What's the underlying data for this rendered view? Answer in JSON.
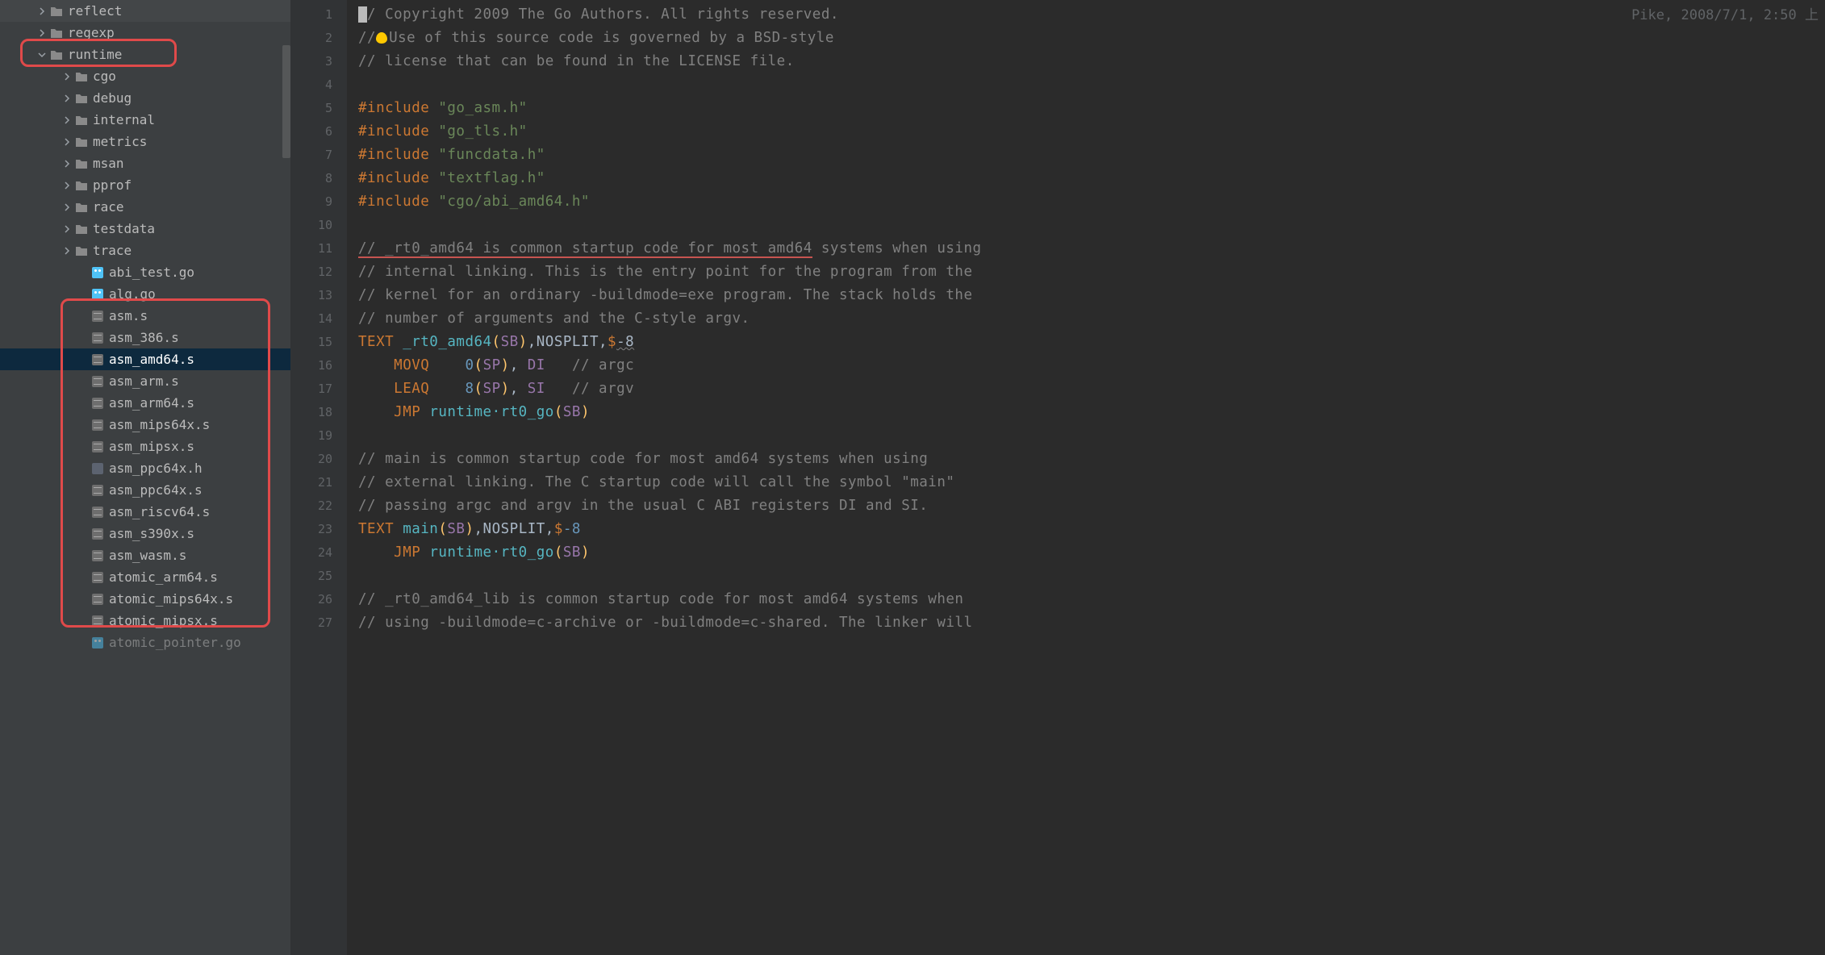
{
  "sidebar": {
    "items": [
      {
        "type": "folder",
        "name": "reflect",
        "indent": 44,
        "chevron": "right"
      },
      {
        "type": "folder",
        "name": "regexp",
        "indent": 44,
        "chevron": "right"
      },
      {
        "type": "folder",
        "name": "runtime",
        "indent": 44,
        "chevron": "down",
        "hl": true
      },
      {
        "type": "folder",
        "name": "cgo",
        "indent": 75,
        "chevron": "right"
      },
      {
        "type": "folder",
        "name": "debug",
        "indent": 75,
        "chevron": "right"
      },
      {
        "type": "folder",
        "name": "internal",
        "indent": 75,
        "chevron": "right"
      },
      {
        "type": "folder",
        "name": "metrics",
        "indent": 75,
        "chevron": "right"
      },
      {
        "type": "folder",
        "name": "msan",
        "indent": 75,
        "chevron": "right"
      },
      {
        "type": "folder",
        "name": "pprof",
        "indent": 75,
        "chevron": "right"
      },
      {
        "type": "folder",
        "name": "race",
        "indent": 75,
        "chevron": "right"
      },
      {
        "type": "folder",
        "name": "testdata",
        "indent": 75,
        "chevron": "right"
      },
      {
        "type": "folder",
        "name": "trace",
        "indent": 75,
        "chevron": "right"
      },
      {
        "type": "go",
        "name": "abi_test.go",
        "indent": 95
      },
      {
        "type": "go",
        "name": "alg.go",
        "indent": 95
      },
      {
        "type": "asm",
        "name": "asm.s",
        "indent": 95
      },
      {
        "type": "asm",
        "name": "asm_386.s",
        "indent": 95
      },
      {
        "type": "asm",
        "name": "asm_amd64.s",
        "indent": 95,
        "selected": true
      },
      {
        "type": "asm",
        "name": "asm_arm.s",
        "indent": 95
      },
      {
        "type": "asm",
        "name": "asm_arm64.s",
        "indent": 95
      },
      {
        "type": "asm",
        "name": "asm_mips64x.s",
        "indent": 95
      },
      {
        "type": "asm",
        "name": "asm_mipsx.s",
        "indent": 95
      },
      {
        "type": "h",
        "name": "asm_ppc64x.h",
        "indent": 95
      },
      {
        "type": "asm",
        "name": "asm_ppc64x.s",
        "indent": 95
      },
      {
        "type": "asm",
        "name": "asm_riscv64.s",
        "indent": 95
      },
      {
        "type": "asm",
        "name": "asm_s390x.s",
        "indent": 95
      },
      {
        "type": "asm",
        "name": "asm_wasm.s",
        "indent": 95
      },
      {
        "type": "asm",
        "name": "atomic_arm64.s",
        "indent": 95
      },
      {
        "type": "asm",
        "name": "atomic_mips64x.s",
        "indent": 95
      },
      {
        "type": "asm",
        "name": "atomic_mipsx.s",
        "indent": 95
      },
      {
        "type": "go",
        "name": "atomic_pointer.go",
        "indent": 95,
        "dim": true
      }
    ]
  },
  "editor": {
    "author_info": "Pike, 2008/7/1, 2:50 上",
    "lines": [
      {
        "n": 1,
        "segs": [
          {
            "t": "cursor"
          },
          {
            "c": "comment",
            "t": "/ Copyright 2009 The Go Authors. All rights reserved."
          }
        ]
      },
      {
        "n": 2,
        "segs": [
          {
            "c": "comment",
            "t": "//"
          },
          {
            "t": "bulb"
          },
          {
            "c": "comment",
            "t": "Use of this source code is governed by a BSD-style"
          }
        ]
      },
      {
        "n": 3,
        "segs": [
          {
            "c": "comment",
            "t": "// license that can be found in the LICENSE file."
          }
        ]
      },
      {
        "n": 4,
        "segs": []
      },
      {
        "n": 5,
        "segs": [
          {
            "c": "preproc",
            "t": "#include"
          },
          {
            "t": " "
          },
          {
            "c": "string",
            "t": "\"go_asm.h\""
          }
        ]
      },
      {
        "n": 6,
        "segs": [
          {
            "c": "preproc",
            "t": "#include"
          },
          {
            "t": " "
          },
          {
            "c": "string",
            "t": "\"go_tls.h\""
          }
        ]
      },
      {
        "n": 7,
        "segs": [
          {
            "c": "preproc",
            "t": "#include"
          },
          {
            "t": " "
          },
          {
            "c": "string",
            "t": "\"funcdata.h\""
          }
        ]
      },
      {
        "n": 8,
        "segs": [
          {
            "c": "preproc",
            "t": "#include"
          },
          {
            "t": " "
          },
          {
            "c": "string",
            "t": "\"textflag.h\""
          }
        ]
      },
      {
        "n": 9,
        "segs": [
          {
            "c": "preproc",
            "t": "#include"
          },
          {
            "t": " "
          },
          {
            "c": "string",
            "t": "\"cgo/abi_amd64.h\""
          }
        ]
      },
      {
        "n": 10,
        "segs": []
      },
      {
        "n": 11,
        "segs": [
          {
            "c": "comment underline-red",
            "t": "// _rt0_amd64 is common startup code for most amd64"
          },
          {
            "c": "comment",
            "t": " systems when using"
          }
        ]
      },
      {
        "n": 12,
        "segs": [
          {
            "c": "comment",
            "t": "// internal linking. This is the entry point for the program from the"
          }
        ]
      },
      {
        "n": 13,
        "segs": [
          {
            "c": "comment",
            "t": "// kernel for an ordinary -buildmode=exe program. The stack holds the"
          }
        ]
      },
      {
        "n": 14,
        "segs": [
          {
            "c": "comment",
            "t": "// number of arguments and the C-style argv."
          }
        ]
      },
      {
        "n": 15,
        "segs": [
          {
            "c": "keyword",
            "t": "TEXT "
          },
          {
            "c": "func",
            "t": "_rt0_amd64"
          },
          {
            "c": "paren-y",
            "t": "("
          },
          {
            "c": "ident",
            "t": "SB"
          },
          {
            "c": "paren-y",
            "t": ")"
          },
          {
            "t": ",NOSPLIT,"
          },
          {
            "c": "keyword",
            "t": "$"
          },
          {
            "c": "squiggle",
            "t": "-8"
          }
        ]
      },
      {
        "n": 16,
        "segs": [
          {
            "t": "    "
          },
          {
            "c": "keyword",
            "t": "MOVQ"
          },
          {
            "t": "    "
          },
          {
            "c": "num",
            "t": "0"
          },
          {
            "c": "paren-y",
            "t": "("
          },
          {
            "c": "ident",
            "t": "SP"
          },
          {
            "c": "paren-y",
            "t": ")"
          },
          {
            "t": ", "
          },
          {
            "c": "ident",
            "t": "DI"
          },
          {
            "t": "   "
          },
          {
            "c": "comment",
            "t": "// argc"
          }
        ]
      },
      {
        "n": 17,
        "segs": [
          {
            "t": "    "
          },
          {
            "c": "keyword",
            "t": "LEAQ"
          },
          {
            "t": "    "
          },
          {
            "c": "num",
            "t": "8"
          },
          {
            "c": "paren-y",
            "t": "("
          },
          {
            "c": "ident",
            "t": "SP"
          },
          {
            "c": "paren-y",
            "t": ")"
          },
          {
            "t": ", "
          },
          {
            "c": "ident",
            "t": "SI"
          },
          {
            "t": "   "
          },
          {
            "c": "comment",
            "t": "// argv"
          }
        ]
      },
      {
        "n": 18,
        "segs": [
          {
            "t": "    "
          },
          {
            "c": "keyword",
            "t": "JMP"
          },
          {
            "t": " "
          },
          {
            "c": "func",
            "t": "runtime·rt0_go"
          },
          {
            "c": "paren-y",
            "t": "("
          },
          {
            "c": "ident",
            "t": "SB"
          },
          {
            "c": "paren-y",
            "t": ")"
          }
        ]
      },
      {
        "n": 19,
        "segs": []
      },
      {
        "n": 20,
        "segs": [
          {
            "c": "comment",
            "t": "// main is common startup code for most amd64 systems when using"
          }
        ]
      },
      {
        "n": 21,
        "segs": [
          {
            "c": "comment",
            "t": "// external linking. The C startup code will call the symbol \"main\""
          }
        ]
      },
      {
        "n": 22,
        "segs": [
          {
            "c": "comment",
            "t": "// passing argc and argv in the usual C ABI registers DI and SI."
          }
        ]
      },
      {
        "n": 23,
        "segs": [
          {
            "c": "keyword",
            "t": "TEXT "
          },
          {
            "c": "func",
            "t": "main"
          },
          {
            "c": "paren-y",
            "t": "("
          },
          {
            "c": "ident",
            "t": "SB"
          },
          {
            "c": "paren-y",
            "t": ")"
          },
          {
            "t": ",NOSPLIT,"
          },
          {
            "c": "keyword",
            "t": "$"
          },
          {
            "c": "num",
            "t": "-8"
          }
        ]
      },
      {
        "n": 24,
        "segs": [
          {
            "t": "    "
          },
          {
            "c": "keyword",
            "t": "JMP"
          },
          {
            "t": " "
          },
          {
            "c": "func",
            "t": "runtime·rt0_go"
          },
          {
            "c": "paren-y",
            "t": "("
          },
          {
            "c": "ident",
            "t": "SB"
          },
          {
            "c": "paren-y",
            "t": ")"
          }
        ]
      },
      {
        "n": 25,
        "segs": []
      },
      {
        "n": 26,
        "segs": [
          {
            "c": "comment",
            "t": "// _rt0_amd64_lib is common startup code for most amd64 systems when"
          }
        ]
      },
      {
        "n": 27,
        "segs": [
          {
            "c": "comment",
            "t": "// using -buildmode=c-archive or -buildmode=c-shared. The linker will"
          }
        ]
      }
    ],
    "markers": [
      386,
      546,
      634
    ]
  }
}
